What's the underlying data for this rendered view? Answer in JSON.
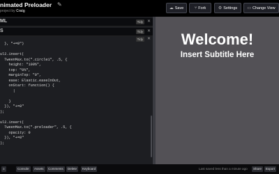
{
  "header": {
    "title": "nimated Preloader",
    "pin_icon": "pin-icon",
    "by_label": "project by",
    "author": "Craig",
    "buttons": [
      {
        "label": "Save",
        "icon": "cloud-icon"
      },
      {
        "label": "Fork",
        "icon": "fork-icon"
      },
      {
        "label": "Settings",
        "icon": "gear-icon"
      },
      {
        "label": "Change View",
        "icon": "monitor-icon"
      }
    ]
  },
  "editor": {
    "panel_top_label": "ML",
    "panel_mid_label": "S",
    "tidy_label": "Tidy",
    "code_lines": [
      "  }, \"+=0\")",
      "",
      "ul2.insert(",
      "  TweenMax.to(\".circle1\", .5, {",
      "    height: \"100%\",",
      "    top: \"0%\",",
      "    marginTop: \"0\",",
      "    ease: Elastic.easeInOut,",
      "    onStart: function() {",
      "      |",
      "",
      "    }",
      "  }), \"+=0\"",
      ");",
      "",
      "ul2.insert(",
      "  TweenMax.to(\".preloader\", .5, {",
      "    opacity: 0",
      "  }), \"+=0\"",
      ");"
    ]
  },
  "preview": {
    "heading": "Welcome!",
    "subtitle": "Insert Subtitle Here"
  },
  "footer": {
    "buttons": [
      "Console",
      "Assets",
      "Comments",
      "Delete",
      "Keyboard"
    ],
    "status": "Last saved less than a minute ago",
    "share_label": "Share",
    "export_label": "Export"
  }
}
